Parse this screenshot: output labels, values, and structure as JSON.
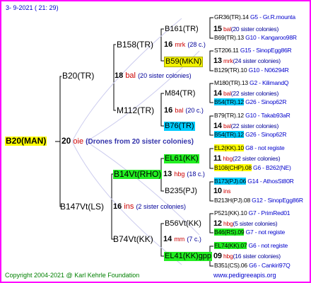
{
  "header": {
    "date": "3-  9-2021",
    "time": "( 21: 29)"
  },
  "root": {
    "label": "B20(MAN)",
    "num": "20",
    "breed": "oie",
    "drones": "(Drones from 20 sister colonies)"
  },
  "gen1": [
    {
      "label": "B20(TR)",
      "num": "18",
      "breed": "bal",
      "note": "(20 sister colonies)"
    },
    {
      "label": "B147Vt(LS)",
      "num": "16",
      "breed": "ins",
      "note": "(2 sister colonies)"
    }
  ],
  "gen2": [
    {
      "label": "B158(TR)",
      "num": "16",
      "breed": "mrk",
      "note": "(28 c.)"
    },
    {
      "label": "M112(TR)",
      "num": "16",
      "breed": "bal",
      "note": "(20 c.)"
    },
    {
      "label": "B14Vt(RHO)",
      "num": "13",
      "breed": "hbg",
      "note": "(18 c.)"
    },
    {
      "label": "B74Vt(KK)",
      "num": "14",
      "breed": "mm",
      "note": "(7 c.)"
    }
  ],
  "gen3": [
    {
      "label": "B161(TR)"
    },
    {
      "label": "B59(MKN)"
    },
    {
      "label": "M84(TR)"
    },
    {
      "label": "B76(TR)"
    },
    {
      "label": "EL61(KK)"
    },
    {
      "label": "B235(PJ)"
    },
    {
      "label": "B56Vt(KK)"
    },
    {
      "label": "EL41(KK)gpp"
    }
  ],
  "gen3info": [
    {
      "num": "15",
      "breed": "bal",
      "note": "(20 sister colonies)"
    },
    {
      "num": "13",
      "breed": "mrk",
      "note": "(24 sister colonies)"
    },
    {
      "num": "14",
      "breed": "bal",
      "note": "(22 sister colonies)"
    },
    {
      "num": "14",
      "breed": "bal",
      "note": "(22 sister colonies)"
    },
    {
      "num": "11",
      "breed": "hbg",
      "note": "(22 sister colonies)"
    },
    {
      "num": "10",
      "breed": "ins",
      "note": ""
    },
    {
      "num": "12",
      "breed": "hbg",
      "note": "(5 sister colonies)"
    },
    {
      "num": "09",
      "breed": "hbg",
      "note": "(16 sister colonies)"
    }
  ],
  "gen4": [
    {
      "label": "GR36(TR).14",
      "info": "G5 - Gr.R.mounta"
    },
    {
      "label": "B69(TR).13",
      "info": "G10 - Kangaroo98R"
    },
    {
      "label": "ST206.11",
      "info": "G15 - SinopEgg86R"
    },
    {
      "label": "B129(TR).10",
      "info": "G10 - N06294R"
    },
    {
      "label": "M180(TR).13",
      "info": "G2 - KilimandQ"
    },
    {
      "label": "B54(TR).12",
      "info": "G26 - Sinop62R"
    },
    {
      "label": "B79(TR).12",
      "info": "G10 - Takab93aR"
    },
    {
      "label": "B54(TR).12",
      "info": "G26 - Sinop62R"
    },
    {
      "label": "EL2(KK).10",
      "info": "G8 - not registe"
    },
    {
      "label": "B108(CHP).08",
      "info": "G6 - B262(NE)"
    },
    {
      "label": "B173(PJ).06",
      "info": "G14 - AthosSt80R"
    },
    {
      "label": "B213H(PJ).08",
      "info": "G12 - SinopEgg86R"
    },
    {
      "label": "P521(KK).10",
      "info": "G7 - PrimRed01"
    },
    {
      "label": "B46(RS).09",
      "info": "G7 - not registe"
    },
    {
      "label": "EL74(KK).07",
      "info": "G6 - not registe"
    },
    {
      "label": "B351(CS).06",
      "info": "G6 - Cankiri97Q"
    }
  ],
  "footer": {
    "copyright": "Copyright 2004-2021 @ Karl Kehrle Foundation",
    "site": "www.pedigreeapis.org"
  },
  "colors": {
    "frame": "#ff00ff",
    "yellow": "#ffff00",
    "green": "#22ee22",
    "cyan": "#00ccff"
  }
}
